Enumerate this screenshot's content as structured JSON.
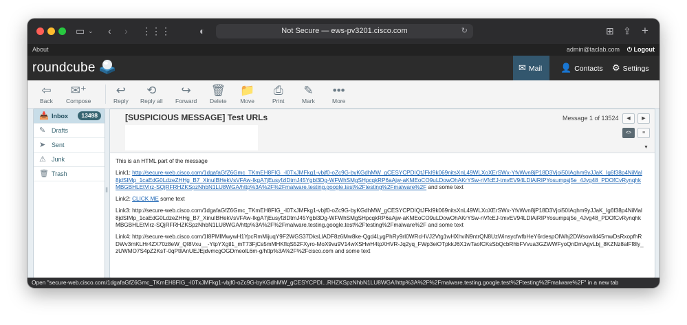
{
  "browser": {
    "url_text": "Not Secure — ews-pv3201.cisco.com",
    "status_text": "Open \"secure-web.cisco.com/1dgafaGfZ6Gmc_TKmEH8FIG_-l0TxJMFkg1-vbjf0-oZc9G-byKGdhMW_gCESYCPDI...RHZKSpzNhbN1LU8WGA/http%3A%2F%2Fmalware.testing.google.test%2Ftesting%2Fmalware%2F\" in a new tab"
  },
  "topbar": {
    "about": "About",
    "user": "admin@taclab.com",
    "logout": "Logout"
  },
  "header": {
    "logo": "roundcube",
    "nav": {
      "mail": "Mail",
      "contacts": "Contacts",
      "settings": "Settings"
    }
  },
  "toolbar": {
    "back": "Back",
    "compose": "Compose",
    "reply": "Reply",
    "reply_all": "Reply all",
    "forward": "Forward",
    "delete": "Delete",
    "move": "Move",
    "print": "Print",
    "mark": "Mark",
    "more": "More"
  },
  "folders": [
    {
      "label": "Inbox",
      "badge": "13498",
      "icon": "inbox-icon"
    },
    {
      "label": "Drafts",
      "icon": "pencil-icon"
    },
    {
      "label": "Sent",
      "icon": "sent-icon"
    },
    {
      "label": "Junk",
      "icon": "junk-icon"
    },
    {
      "label": "Trash",
      "icon": "trash-icon"
    }
  ],
  "message": {
    "subject": "[SUSPICIOUS MESSAGE] Test URLs",
    "counter": "Message 1 of 13524",
    "intro": "This is an HTML part of the message",
    "link1_label": "Link1:",
    "link1_url": "http://secure-web.cisco.com/1dgafaGfZ6Gmc_TKmEH8FIG_-l0TxJMFkg1-vbjf0-oZc9G-byKGdhMW_gCESYCPDIQtJFkI9k069nitsXnL49WLXoXErSWx-YfvWvn8jP18D3Vjoi50IAqhm9yJJaK_Ig6f38p4NiMal8jdSIMp_1caEdG0LdzeZHHg_B7_XinuIBHekVsVFAw-IkgA7jEusyfzlDtmJ45Ygbl3Dg-WFWhSMgSHpcqkRP6aAjw-aKMEoCO9uLDowOhAKrYSw-nVfcEJ-tmvEV94LDIAiRIPYosumpsj5e_4Jvg48_PDOfCvRynqhkMBGBHLEtVirz-SQjRFRHZKSpzNhbN1LU8WGA/http%3A%2F%2Fmalware.testing.google.test%2Ftesting%2Fmalware%2F",
    "some_text": "and some text",
    "link2_label": "Link2:",
    "link2_text": "CLICK ME",
    "link2_tail": "some text",
    "link3_text": "Link3: http://secure-web.cisco.com/1dgafaGfZ6Gmc_TKmEH8FIG_-l0TxJMFkg1-vbjf0-oZc9G-byKGdhMW_gCESYCPDIQtJFkI9k069nitsXnL49WLXoXErSWx-YfvWvn8jP18D3Vjoi50IAqhm9yJJaK_Ig6f38p4NiMal8jdSIMp_1caEdG0LdzeZHHg_B7_XinuIBHekVsVFAw-IkgA7jEusyfzlDtmJ45Ygbl3Dg-WFWhSMgSHpcqkRP6aAjw-aKMEoCO9uLDowOhAKrYSw-nVfcEJ-tmvEV94LDIAiRIPYosumpsj5e_4Jvg48_PDOfCvRynqhkMBGBHLEtVirz-SQjRFRHZKSpzNhbN1LU8WGA/http%3A%2F%2Fmalware.testing.google.test%2Ftesting%2Fmalware%2F and some text",
    "link4_text": "Link4: http://secure-web.cisco.com/1I8PMIMwywH1YpcRmMijuqY9F2WGS37DksLlADF8z6Mw8ke-Qgd4LygPhRy9rI0WRcHVJ2Vtg1wHXhviN9ntrQN8UzWinsycfwfbHeY6rdespOlWhj2DWsowild45mwDsRxopfhRDWv3mKLHr4ZX70z8eW_QI8Vxu__-YtpYXgtl1_mT73FjCs5mMHKflqS52FXyro-MoX9vu9V14wXSHwH4tpXHVR-Jq2yq_FWp3eiOTpkkJ6X1wTaofCKsSbQcbRhbFVvua3GZWWFyoQnDmAgvLbj_8KZNz8alFf8ly_zUWMO7S4pZ2KsT-0qPtllAnUEJEjdvmcgOGDmeolL6m-g/http%3A%2F%2Fcisco.com and some text"
  },
  "colors": {
    "accent": "#376572",
    "link": "#1a63b3",
    "header_bg": "#2c2c2c",
    "selected_folder": "#c8dde8"
  }
}
